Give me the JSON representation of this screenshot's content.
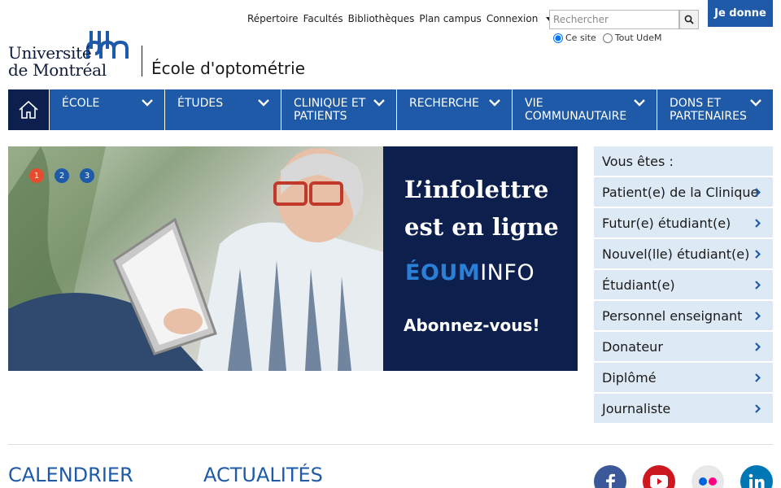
{
  "utility_links": [
    "Répertoire",
    "Facultés",
    "Bibliothèques",
    "Plan campus",
    "Connexion"
  ],
  "search": {
    "placeholder": "Rechercher",
    "options": [
      "Ce site",
      "Tout UdeM"
    ],
    "selected": "Ce site"
  },
  "donate_label": "Je donne",
  "logo": {
    "line1": "Université",
    "line2": "de Montréal"
  },
  "school_name": "École d'optométrie",
  "nav": {
    "home_icon": "home-icon",
    "items": [
      {
        "label": "École"
      },
      {
        "label": "Études"
      },
      {
        "label": "Clinique et patients"
      },
      {
        "label": "Recherche"
      },
      {
        "label": "Vie communautaire"
      },
      {
        "label": "Dons et partenaires"
      }
    ]
  },
  "hero": {
    "headline_line1": "L’infolettre",
    "headline_line2": "est en ligne",
    "brand_part1": "ÉOUM",
    "brand_part2": "INFO",
    "cta": "Abonnez-vous!",
    "slides": [
      "1",
      "2",
      "3"
    ],
    "active_slide": 1
  },
  "audience": {
    "title": "Vous êtes :",
    "items": [
      "Patient(e) de la Clinique",
      "Futur(e) étudiant(e)",
      "Nouvel(lle) étudiant(e)",
      "Étudiant(e)",
      "Personnel enseignant",
      "Donateur",
      "Diplômé",
      "Journaliste"
    ]
  },
  "sections": {
    "calendar": "Calendrier",
    "news": "Actualités"
  },
  "social": [
    {
      "name": "facebook-icon",
      "color": "#3b5998"
    },
    {
      "name": "youtube-icon",
      "color": "#cc181e"
    },
    {
      "name": "flickr-icon",
      "color": "#e8e8e8"
    },
    {
      "name": "linkedin-icon",
      "color": "#0077b5"
    }
  ],
  "colors": {
    "primary": "#1e5aa8",
    "dark": "#0d1f4d",
    "accent": "#e74c2e",
    "side_bg": "#dde9f5"
  }
}
